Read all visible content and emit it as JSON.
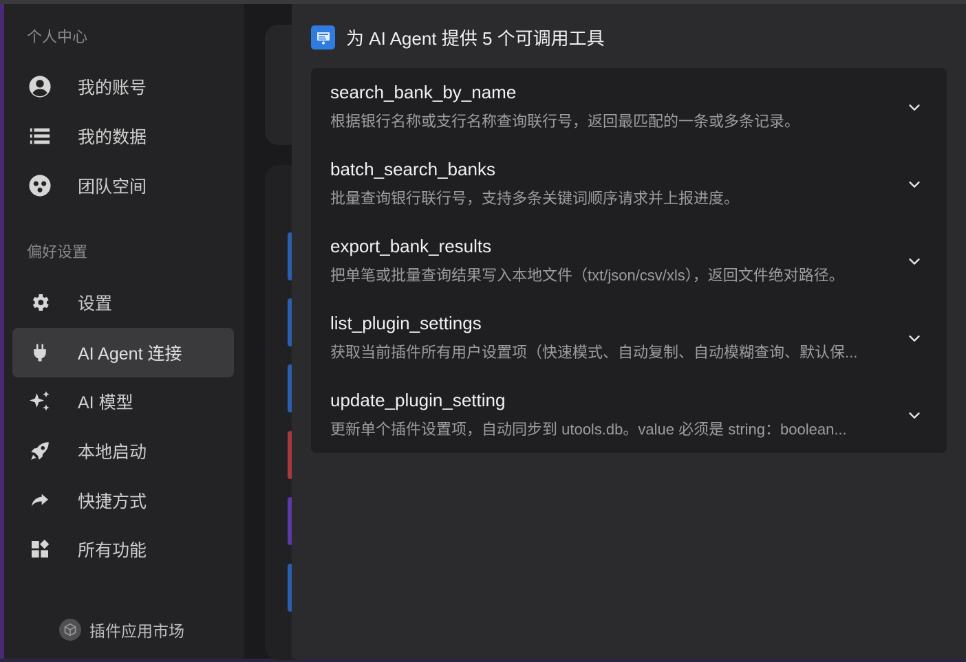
{
  "sidebar": {
    "personal_section": "个人中心",
    "preferences_section": "偏好设置",
    "personal_items": [
      {
        "label": "我的账号",
        "icon": "account-circle-icon"
      },
      {
        "label": "我的数据",
        "icon": "data-list-icon"
      },
      {
        "label": "团队空间",
        "icon": "team-icon"
      }
    ],
    "preference_items": [
      {
        "label": "设置",
        "icon": "gear-icon"
      },
      {
        "label": "AI Agent 连接",
        "icon": "plug-icon",
        "active": true
      },
      {
        "label": "AI 模型",
        "icon": "sparkle-icon"
      },
      {
        "label": "本地启动",
        "icon": "rocket-icon"
      },
      {
        "label": "快捷方式",
        "icon": "share-arrow-icon"
      },
      {
        "label": "所有功能",
        "icon": "widgets-icon"
      }
    ],
    "market_label": "插件应用市场"
  },
  "panel": {
    "title": "为 AI Agent 提供 5 个可调用工具",
    "tools": [
      {
        "name": "search_bank_by_name",
        "description": "根据银行名称或支行名称查询联行号，返回最匹配的一条或多条记录。"
      },
      {
        "name": "batch_search_banks",
        "description": "批量查询银行联行号，支持多条关键词顺序请求并上报进度。"
      },
      {
        "name": "export_bank_results",
        "description": "把单笔或批量查询结果写入本地文件（txt/json/csv/xls），返回文件绝对路径。"
      },
      {
        "name": "list_plugin_settings",
        "description": "获取当前插件所有用户设置项（快速模式、自动复制、自动模糊查询、默认保..."
      },
      {
        "name": "update_plugin_setting",
        "description": "更新单个插件设置项，自动同步到 utools.db。value 必须是 string：boolean..."
      }
    ]
  },
  "colors": {
    "accent_blue": "#2f7be0",
    "sidebar_bg": "#232325",
    "panel_bg": "#2b2b2e",
    "list_bg": "#1f1f21"
  }
}
